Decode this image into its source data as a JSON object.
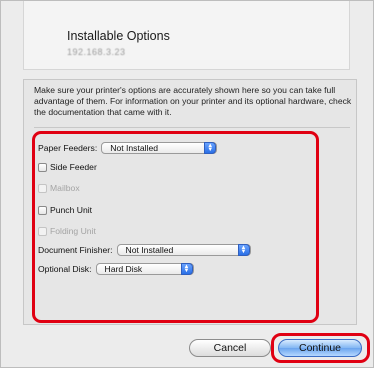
{
  "dialog": {
    "title": "Installable Options",
    "printer_address": "192.168.3.23",
    "description": "Make sure your printer's options are accurately shown here so you can take full advantage of them.  For information on your printer and its optional hardware, check the documentation that came with it."
  },
  "options": {
    "paper_feeders": {
      "label": "Paper Feeders:",
      "value": "Not Installed"
    },
    "side_feeder": {
      "label": "Side Feeder",
      "checked": false,
      "enabled": true
    },
    "mailbox": {
      "label": "Mailbox",
      "checked": false,
      "enabled": false
    },
    "punch_unit": {
      "label": "Punch Unit",
      "checked": false,
      "enabled": true
    },
    "folding_unit": {
      "label": "Folding Unit",
      "checked": false,
      "enabled": false
    },
    "document_finisher": {
      "label": "Document Finisher:",
      "value": "Not Installed"
    },
    "optional_disk": {
      "label": "Optional Disk:",
      "value": "Hard Disk"
    }
  },
  "buttons": {
    "cancel": "Cancel",
    "continue": "Continue"
  },
  "colors": {
    "highlight": "#e00012",
    "default_button": "#82b6f3",
    "popup_arrows": "#2a6fe6"
  }
}
